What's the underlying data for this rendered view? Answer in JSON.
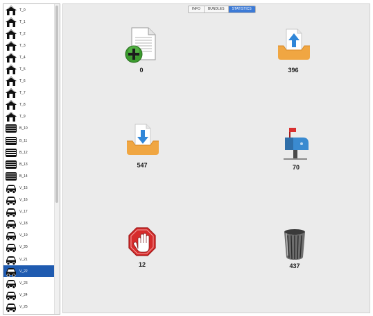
{
  "sidebar": {
    "nodes": [
      {
        "label": "T_0",
        "icon": "house-icon"
      },
      {
        "label": "T_1",
        "icon": "house-icon"
      },
      {
        "label": "T_2",
        "icon": "house-icon"
      },
      {
        "label": "T_3",
        "icon": "house-icon"
      },
      {
        "label": "T_4",
        "icon": "house-icon"
      },
      {
        "label": "T_5",
        "icon": "house-icon"
      },
      {
        "label": "T_6",
        "icon": "house-icon"
      },
      {
        "label": "T_7",
        "icon": "house-icon"
      },
      {
        "label": "T_8",
        "icon": "house-icon"
      },
      {
        "label": "T_9",
        "icon": "house-icon"
      },
      {
        "label": "B_10",
        "icon": "bus-icon"
      },
      {
        "label": "B_11",
        "icon": "bus-icon"
      },
      {
        "label": "B_12",
        "icon": "bus-icon"
      },
      {
        "label": "B_13",
        "icon": "bus-icon"
      },
      {
        "label": "B_14",
        "icon": "bus-icon"
      },
      {
        "label": "V_15",
        "icon": "car-icon"
      },
      {
        "label": "V_16",
        "icon": "car-icon"
      },
      {
        "label": "V_17",
        "icon": "car-icon"
      },
      {
        "label": "V_18",
        "icon": "car-icon"
      },
      {
        "label": "V_19",
        "icon": "car-icon"
      },
      {
        "label": "V_20",
        "icon": "car-icon"
      },
      {
        "label": "V_21",
        "icon": "car-icon"
      },
      {
        "label": "V_22",
        "icon": "car-icon",
        "selected": true
      },
      {
        "label": "V_23",
        "icon": "car-icon"
      },
      {
        "label": "V_24",
        "icon": "car-icon"
      },
      {
        "label": "V_25",
        "icon": "car-icon"
      }
    ]
  },
  "tabs": [
    {
      "label": "INFO",
      "active": false
    },
    {
      "label": "BUNDLES",
      "active": false
    },
    {
      "label": "STATISTICS",
      "active": true
    }
  ],
  "colors": {
    "selection": "#1f5bb0",
    "active_tab": "#3c7ad6",
    "tray_orange": "#f0a642",
    "arrow_blue": "#2f86d8",
    "stop_red": "#d62b2b",
    "add_green": "#3b9a2e"
  },
  "stats": {
    "created": {
      "value": "0",
      "icon": "new-document-icon"
    },
    "sent": {
      "value": "396",
      "icon": "outbox-upload-icon"
    },
    "received": {
      "value": "547",
      "icon": "inbox-download-icon"
    },
    "delivered": {
      "value": "70",
      "icon": "mailbox-icon"
    },
    "aborted": {
      "value": "12",
      "icon": "stop-hand-icon"
    },
    "dropped": {
      "value": "437",
      "icon": "trash-can-icon"
    }
  }
}
